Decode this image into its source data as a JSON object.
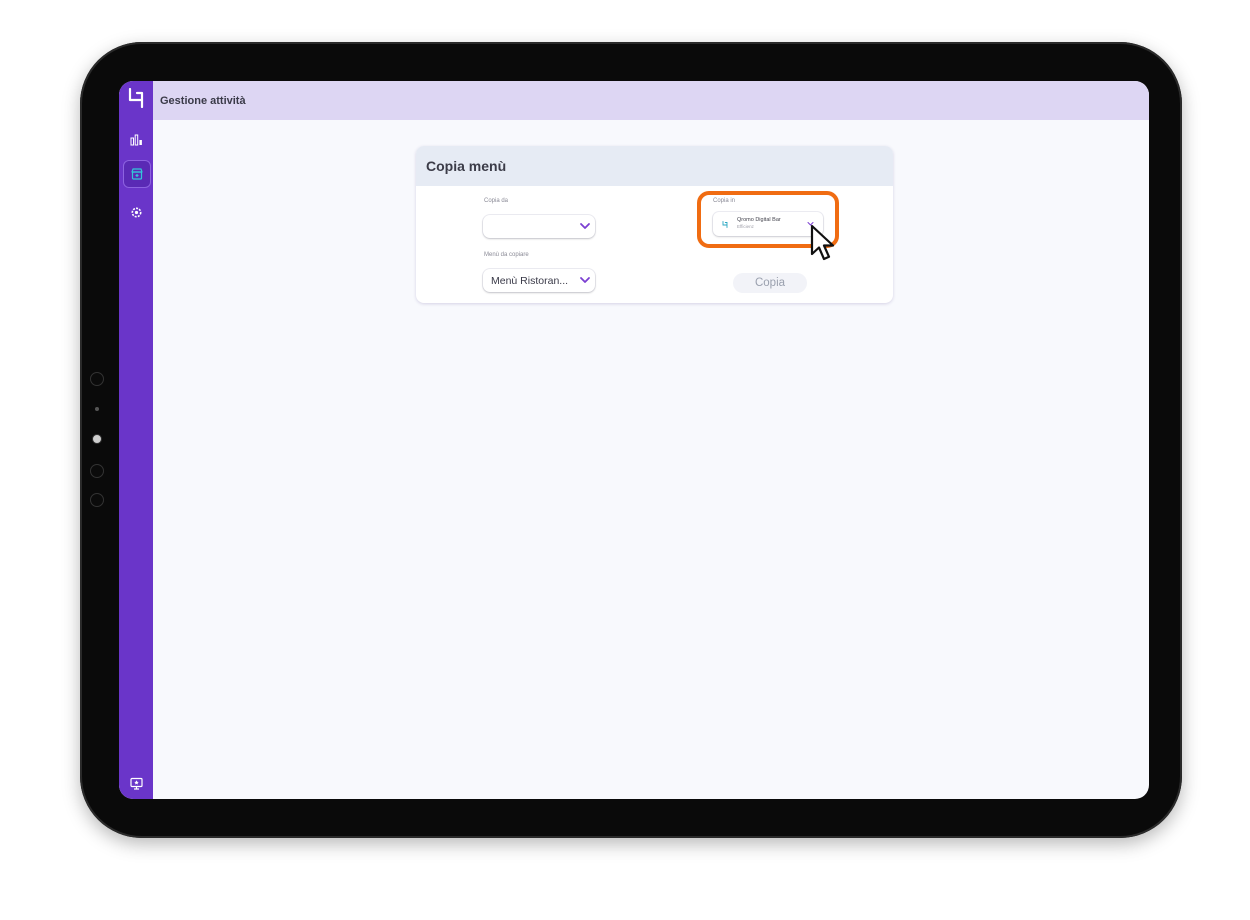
{
  "topbar": {
    "title": "Gestione attività"
  },
  "sidebar": {
    "items": [
      {
        "icon": "bar-chart-icon"
      },
      {
        "icon": "store-icon",
        "active": true
      },
      {
        "icon": "gear-icon"
      },
      {
        "icon": "monitor-icon"
      }
    ]
  },
  "card": {
    "title": "Copia menù",
    "copy_from_label": "Copia da",
    "menu_label": "Menù da copiare",
    "menu_value": "Menù Ristoran...",
    "copy_to_label": "Copia in",
    "copy_to_name": "Qromo Digital Bar",
    "copy_to_sub": "Efficienz",
    "copy_button": "Copia"
  },
  "colors": {
    "sidebar": "#6a35c9",
    "topbar": "#ddd6f3",
    "highlight": "#f06c12",
    "accent": "#7b3fd1"
  }
}
